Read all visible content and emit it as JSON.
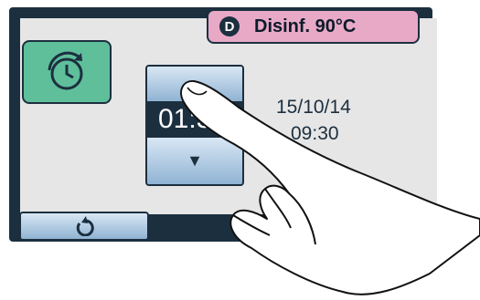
{
  "header": {
    "badge_letter": "D",
    "badge_label": "Disinf. 90°C"
  },
  "timer": {
    "value": "01:3"
  },
  "datetime": {
    "date": "15/10/14",
    "time": "09:30"
  },
  "icons": {
    "timer_tile": "timer-clock-icon",
    "picker_down": "down-arrow-icon",
    "back": "undo-arrow-icon",
    "hand": "pointing-hand-icon"
  },
  "colors": {
    "badge": "#e8a9c7",
    "timer_tile": "#5fbf9b",
    "frame": "#1c2f3f",
    "button": "#8fb3d3"
  }
}
